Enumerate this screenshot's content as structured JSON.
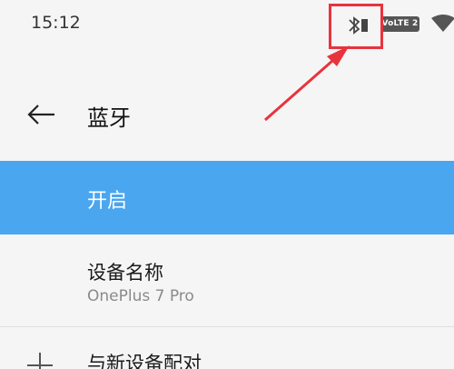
{
  "status_bar": {
    "time": "15:12",
    "network_badge": "VoLTE 2",
    "icons": [
      "bluetooth-icon",
      "battery-icon",
      "wifi-icon"
    ]
  },
  "annotation": {
    "color": "#e8333d"
  },
  "header": {
    "title": "蓝牙",
    "back_icon": "arrow-left-icon"
  },
  "bluetooth_toggle": {
    "label": "开启",
    "state": "on",
    "accent": "#4aa6ef"
  },
  "device_name": {
    "title": "设备名称",
    "value": "OnePlus 7 Pro"
  },
  "pair_new": {
    "label": "与新设备配对",
    "icon": "plus-icon"
  }
}
